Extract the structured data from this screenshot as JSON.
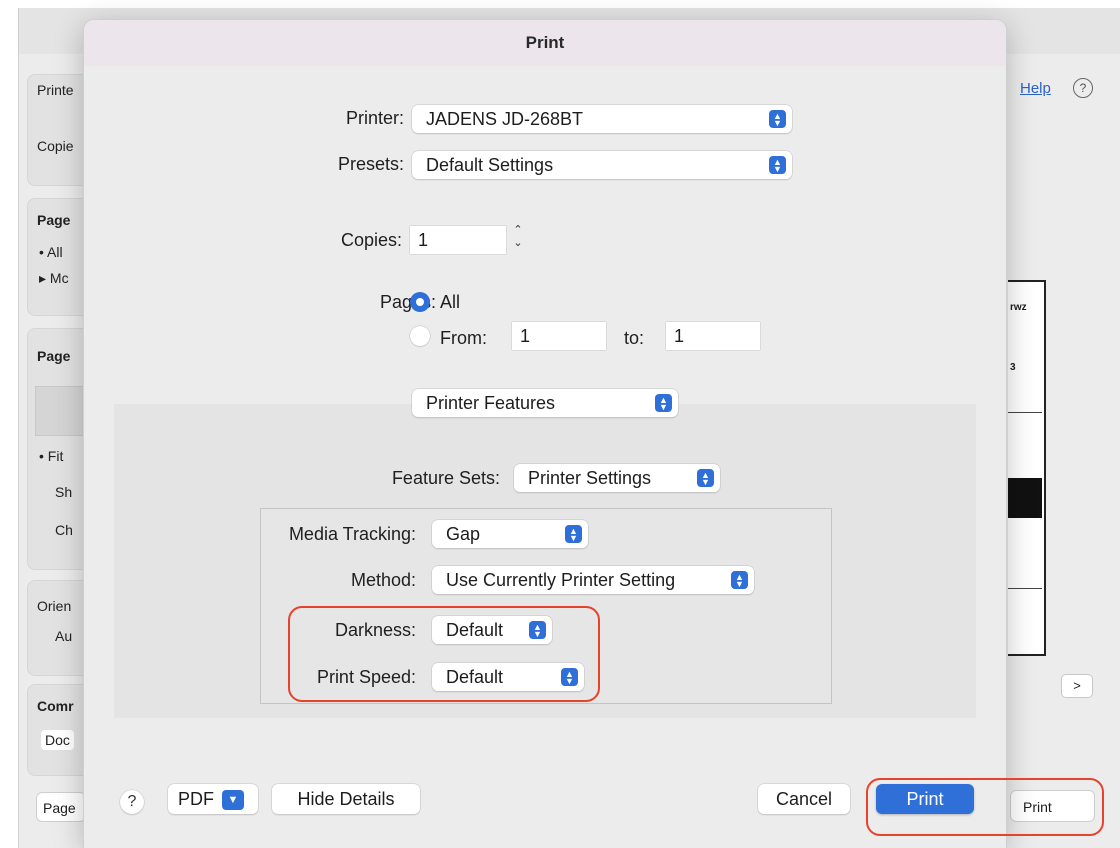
{
  "background_window": {
    "left_labels": [
      "Printe",
      "Copie",
      "Page",
      "All",
      "Mc",
      "Page",
      "Fit",
      "Sh",
      "Ch",
      "Orien",
      "Au",
      "Comr",
      "Doc"
    ],
    "help_link": "Help",
    "help_icon": "?",
    "next_button": ">",
    "print_button": "Print",
    "page_button": "Page",
    "preview_text_top": "rwz",
    "preview_text_mid": "3"
  },
  "dialog": {
    "title": "Print",
    "printer": {
      "label": "Printer:",
      "value": "JADENS JD-268BT"
    },
    "presets": {
      "label": "Presets:",
      "value": "Default Settings"
    },
    "copies": {
      "label": "Copies:",
      "value": "1"
    },
    "pages": {
      "label": "Pages:",
      "all_label": "All",
      "from_label": "From:",
      "from_value": "1",
      "to_label": "to:",
      "to_value": "1",
      "selected": "All"
    },
    "section_popup": "Printer Features",
    "feature_sets": {
      "label": "Feature Sets:",
      "value": "Printer Settings"
    },
    "media_tracking": {
      "label": "Media Tracking:",
      "value": "Gap"
    },
    "method": {
      "label": "Method:",
      "value": "Use Currently Printer Setting"
    },
    "darkness": {
      "label": "Darkness:",
      "value": "Default"
    },
    "print_speed": {
      "label": "Print Speed:",
      "value": "Default"
    },
    "footer": {
      "help": "?",
      "pdf_label": "PDF",
      "hide_details": "Hide Details",
      "cancel": "Cancel",
      "print": "Print"
    }
  },
  "colors": {
    "accent": "#2f6fd8",
    "highlight": "#e8412c"
  }
}
